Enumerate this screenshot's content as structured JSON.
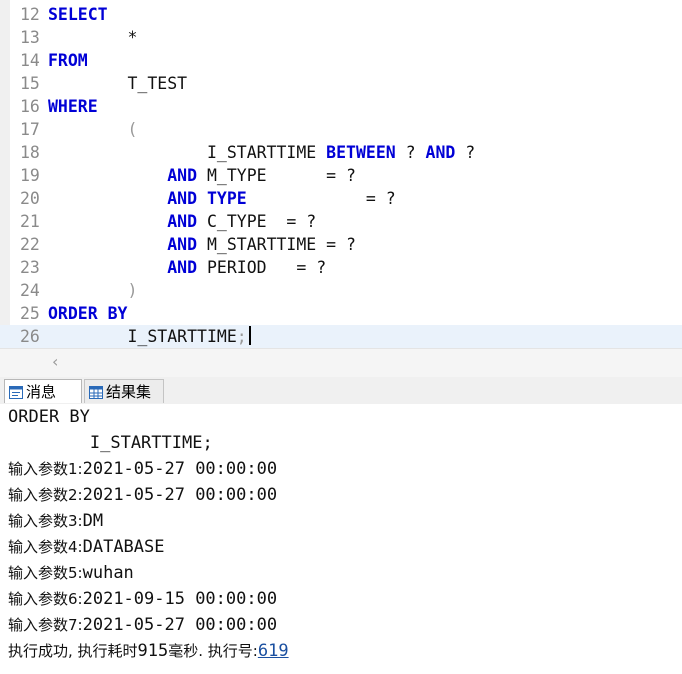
{
  "editor": {
    "lines": [
      {
        "num": "12",
        "indent": "",
        "segments": [
          {
            "t": "SELECT",
            "k": "kw"
          }
        ]
      },
      {
        "num": "13",
        "indent": "        ",
        "segments": [
          {
            "t": "*",
            "k": ""
          }
        ]
      },
      {
        "num": "14",
        "indent": "",
        "segments": [
          {
            "t": "FROM",
            "k": "kw"
          }
        ]
      },
      {
        "num": "15",
        "indent": "        ",
        "segments": [
          {
            "t": "T_TEST",
            "k": ""
          }
        ]
      },
      {
        "num": "16",
        "indent": "",
        "segments": [
          {
            "t": "WHERE",
            "k": "kw"
          }
        ]
      },
      {
        "num": "17",
        "indent": "        ",
        "segments": [
          {
            "t": "(",
            "k": "paren"
          }
        ]
      },
      {
        "num": "18",
        "indent": "                ",
        "segments": [
          {
            "t": "I_STARTTIME ",
            "k": ""
          },
          {
            "t": "BETWEEN",
            "k": "kw"
          },
          {
            "t": " ? ",
            "k": ""
          },
          {
            "t": "AND",
            "k": "kw"
          },
          {
            "t": " ?",
            "k": ""
          }
        ]
      },
      {
        "num": "19",
        "indent": "            ",
        "segments": [
          {
            "t": "AND",
            "k": "kw"
          },
          {
            "t": " M_TYPE      = ?",
            "k": ""
          }
        ]
      },
      {
        "num": "20",
        "indent": "            ",
        "segments": [
          {
            "t": "AND",
            "k": "kw"
          },
          {
            "t": " ",
            "k": ""
          },
          {
            "t": "TYPE",
            "k": "kw"
          },
          {
            "t": "            = ?",
            "k": ""
          }
        ]
      },
      {
        "num": "21",
        "indent": "            ",
        "segments": [
          {
            "t": "AND",
            "k": "kw"
          },
          {
            "t": " C_TYPE  = ?",
            "k": ""
          }
        ]
      },
      {
        "num": "22",
        "indent": "            ",
        "segments": [
          {
            "t": "AND",
            "k": "kw"
          },
          {
            "t": " M_STARTTIME = ?",
            "k": ""
          }
        ]
      },
      {
        "num": "23",
        "indent": "            ",
        "segments": [
          {
            "t": "AND",
            "k": "kw"
          },
          {
            "t": " PERIOD   = ?",
            "k": ""
          }
        ]
      },
      {
        "num": "24",
        "indent": "        ",
        "segments": [
          {
            "t": ")",
            "k": "paren"
          }
        ]
      },
      {
        "num": "25",
        "indent": "",
        "segments": [
          {
            "t": "ORDER BY",
            "k": "kw"
          }
        ]
      },
      {
        "num": "26",
        "indent": "        ",
        "segments": [
          {
            "t": "I_STARTTIME",
            "k": ""
          },
          {
            "t": ";",
            "k": "semi"
          }
        ],
        "current": true
      }
    ],
    "scroll_left_glyph": "‹"
  },
  "tabs": {
    "messages_label": "消息",
    "results_label": "结果集"
  },
  "messages": {
    "line1": "ORDER BY",
    "line2": "        I_STARTTIME;",
    "params": [
      {
        "label": "输入参数1:",
        "value": "2021-05-27 00:00:00"
      },
      {
        "label": "输入参数2:",
        "value": "2021-05-27 00:00:00"
      },
      {
        "label": "输入参数3:",
        "value": "DM"
      },
      {
        "label": "输入参数4:",
        "value": "DATABASE"
      },
      {
        "label": "输入参数5:",
        "value": "wuhan"
      },
      {
        "label": "输入参数6:",
        "value": "2021-09-15 00:00:00"
      },
      {
        "label": "输入参数7:",
        "value": "2021-05-27 00:00:00"
      }
    ],
    "status_prefix": "执行成功, 执行耗时",
    "elapsed": "915",
    "status_mid": "毫秒. 执行号:",
    "exec_no": "619"
  }
}
